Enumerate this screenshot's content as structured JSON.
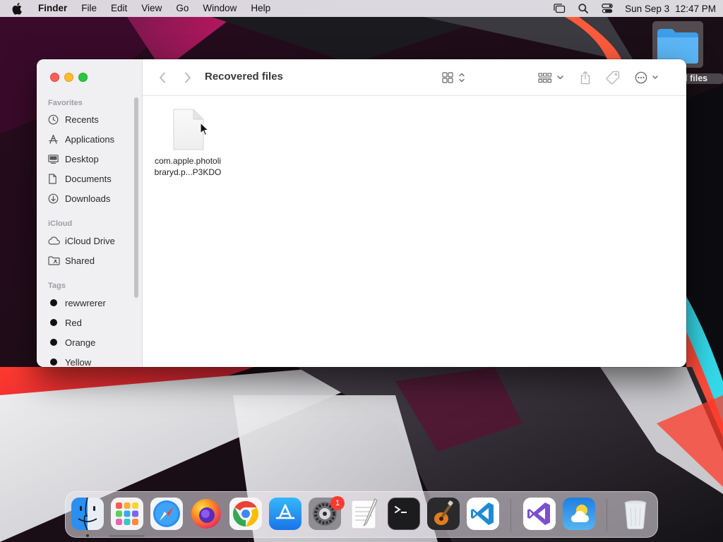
{
  "menubar": {
    "app_name": "Finder",
    "menus": [
      "File",
      "Edit",
      "View",
      "Go",
      "Window",
      "Help"
    ],
    "date": "Sun Sep 3",
    "time": "12:47 PM"
  },
  "desktop": {
    "folder_label": "d files"
  },
  "finder": {
    "title": "Recovered files",
    "sidebar": {
      "favorites_header": "Favorites",
      "favorites": [
        {
          "label": "Recents",
          "icon": "clock-icon"
        },
        {
          "label": "Applications",
          "icon": "applications-icon"
        },
        {
          "label": "Desktop",
          "icon": "desktop-icon"
        },
        {
          "label": "Documents",
          "icon": "document-icon"
        },
        {
          "label": "Downloads",
          "icon": "download-icon"
        }
      ],
      "icloud_header": "iCloud",
      "icloud": [
        {
          "label": "iCloud Drive",
          "icon": "cloud-icon"
        },
        {
          "label": "Shared",
          "icon": "shared-folder-icon"
        }
      ],
      "tags_header": "Tags",
      "tags": [
        {
          "label": "rewwrerer",
          "color": "#111111"
        },
        {
          "label": "Red",
          "color": "#111111"
        },
        {
          "label": "Orange",
          "color": "#111111"
        },
        {
          "label": "Yellow",
          "color": "#111111"
        }
      ]
    },
    "files": [
      {
        "name_line1": "com.apple.photoli",
        "name_line2": "braryd.p...P3KDO",
        "icon": "generic-document-icon"
      }
    ]
  },
  "dock": {
    "apps": [
      {
        "name": "Finder",
        "icon": "finder-icon",
        "running": true
      },
      {
        "name": "Launchpad",
        "icon": "launchpad-icon",
        "running": false
      },
      {
        "name": "Safari",
        "icon": "safari-icon",
        "running": false
      },
      {
        "name": "Firefox",
        "icon": "firefox-icon",
        "running": false
      },
      {
        "name": "Chrome",
        "icon": "chrome-icon",
        "running": false
      },
      {
        "name": "App Store",
        "icon": "app-store-icon",
        "running": false
      },
      {
        "name": "System Settings",
        "icon": "settings-icon",
        "running": false,
        "badge": "1"
      },
      {
        "name": "TextEdit",
        "icon": "textedit-icon",
        "running": false
      },
      {
        "name": "Terminal",
        "icon": "terminal-icon",
        "running": false
      },
      {
        "name": "GarageBand",
        "icon": "garageband-icon",
        "running": false
      },
      {
        "name": "VS Code",
        "icon": "vscode-icon",
        "running": false
      },
      {
        "name": "Visual Studio",
        "icon": "visual-studio-icon",
        "running": false
      },
      {
        "name": "Weather",
        "icon": "weather-icon",
        "running": false
      },
      {
        "name": "Trash",
        "icon": "trash-icon",
        "running": false
      }
    ]
  }
}
